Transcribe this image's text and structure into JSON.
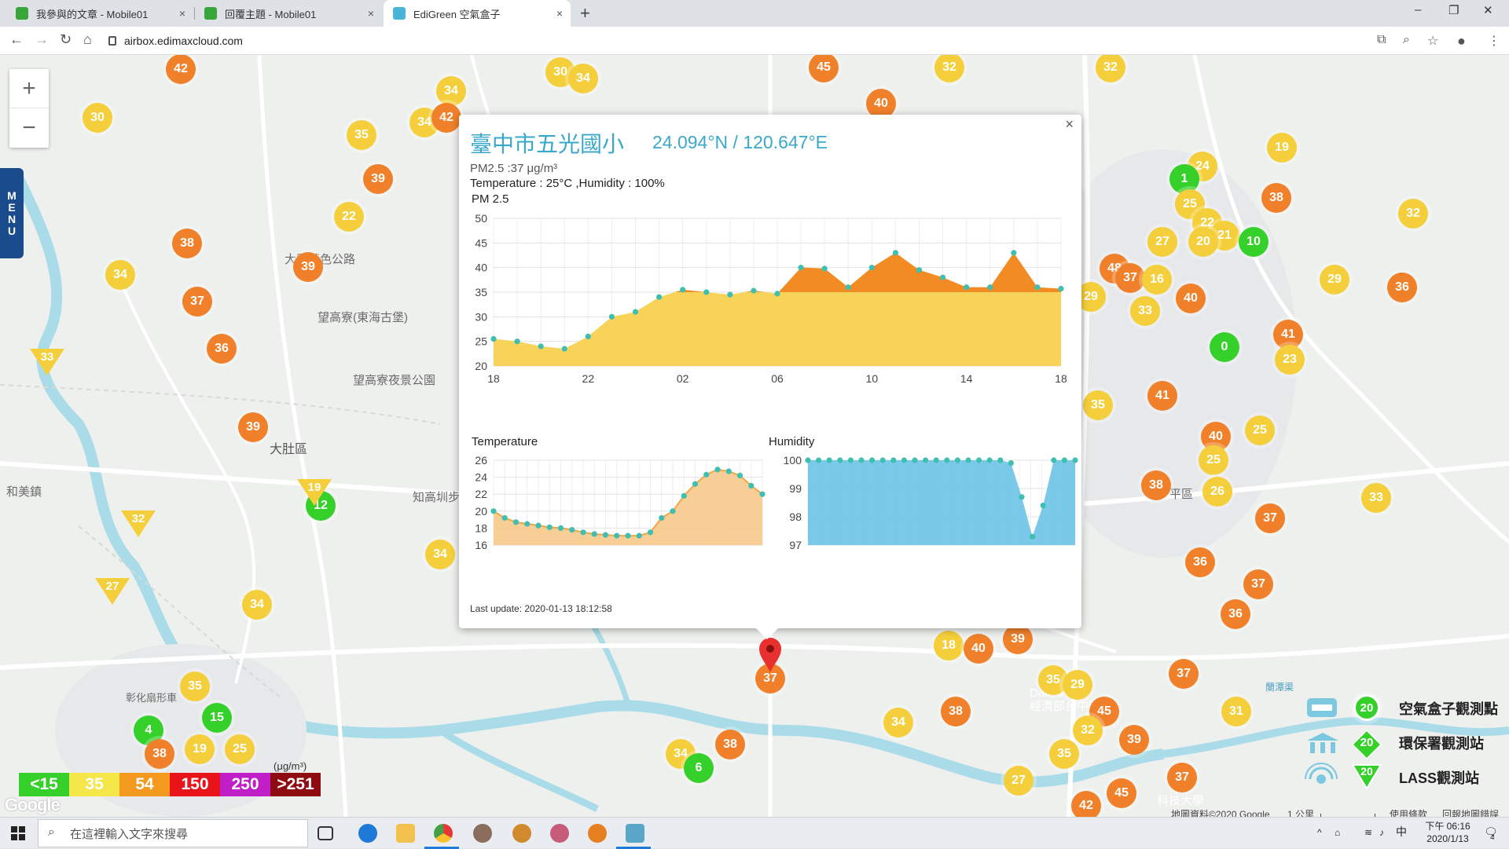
{
  "browser": {
    "tabs": [
      {
        "label": "我參與的文章 - Mobile01",
        "close": "×"
      },
      {
        "label": "回覆主題 - Mobile01",
        "close": "×"
      },
      {
        "label": "EdiGreen 空氣盒子",
        "close": "×"
      }
    ],
    "new_tab": "+",
    "url": "airbox.edimaxcloud.com",
    "window_controls": {
      "minimize": "–",
      "restore": "❐",
      "close": "✕"
    }
  },
  "map": {
    "zoom_in": "+",
    "zoom_out": "−",
    "menu_label": "MENU",
    "place_labels": [
      "大肚區",
      "知高圳步",
      "大肚藍色公路",
      "望高寮(東海古堡)",
      "望高寮夜景公園",
      "和美鎮",
      "彰化扇形車",
      "平區",
      "Dali Ar",
      "經濟部台中軟體",
      "科技大學",
      "蘭潭渠"
    ],
    "markers": [
      {
        "v": "42",
        "t": "o",
        "x": 230,
        "y": 88
      },
      {
        "v": "30",
        "t": "y",
        "x": 124,
        "y": 150
      },
      {
        "v": "30",
        "t": "y",
        "x": 713,
        "y": 92
      },
      {
        "v": "34",
        "t": "y",
        "x": 742,
        "y": 100
      },
      {
        "v": "34",
        "t": "y",
        "x": 574,
        "y": 116
      },
      {
        "v": "34",
        "t": "y",
        "x": 540,
        "y": 156
      },
      {
        "v": "42",
        "t": "o",
        "x": 568,
        "y": 150
      },
      {
        "v": "45",
        "t": "o",
        "x": 1048,
        "y": 86
      },
      {
        "v": "40",
        "t": "o",
        "x": 1121,
        "y": 132
      },
      {
        "v": "32",
        "t": "y",
        "x": 1208,
        "y": 86
      },
      {
        "v": "32",
        "t": "y",
        "x": 1413,
        "y": 86
      },
      {
        "v": "35",
        "t": "y",
        "x": 460,
        "y": 172
      },
      {
        "v": "39",
        "t": "o",
        "x": 481,
        "y": 228
      },
      {
        "v": "22",
        "t": "y",
        "x": 444,
        "y": 276
      },
      {
        "v": "38",
        "t": "o",
        "x": 238,
        "y": 310
      },
      {
        "v": "39",
        "t": "o",
        "x": 392,
        "y": 340
      },
      {
        "v": "34",
        "t": "y",
        "x": 153,
        "y": 350
      },
      {
        "v": "37",
        "t": "o",
        "x": 251,
        "y": 384
      },
      {
        "v": "36",
        "t": "o",
        "x": 282,
        "y": 444
      },
      {
        "v": "39",
        "t": "o",
        "x": 322,
        "y": 544
      },
      {
        "v": "12",
        "t": "g",
        "x": 408,
        "y": 644
      },
      {
        "v": "34",
        "t": "y",
        "x": 560,
        "y": 706
      },
      {
        "v": "34",
        "t": "y",
        "x": 327,
        "y": 770
      },
      {
        "v": "35",
        "t": "y",
        "x": 248,
        "y": 874
      },
      {
        "v": "15",
        "t": "g",
        "x": 276,
        "y": 914
      },
      {
        "v": "4",
        "t": "g",
        "x": 189,
        "y": 930
      },
      {
        "v": "38",
        "t": "o",
        "x": 203,
        "y": 960
      },
      {
        "v": "19",
        "t": "y",
        "x": 254,
        "y": 954
      },
      {
        "v": "25",
        "t": "y",
        "x": 305,
        "y": 954
      },
      {
        "v": "34",
        "t": "y",
        "x": 866,
        "y": 960
      },
      {
        "v": "6",
        "t": "g",
        "x": 889,
        "y": 978
      },
      {
        "v": "38",
        "t": "o",
        "x": 929,
        "y": 948
      },
      {
        "v": "18",
        "t": "y",
        "x": 1207,
        "y": 822
      },
      {
        "v": "40",
        "t": "o",
        "x": 1245,
        "y": 826
      },
      {
        "v": "39",
        "t": "o",
        "x": 1295,
        "y": 814
      },
      {
        "v": "34",
        "t": "y",
        "x": 1143,
        "y": 920
      },
      {
        "v": "38",
        "t": "o",
        "x": 1216,
        "y": 906
      },
      {
        "v": "35",
        "t": "y",
        "x": 1340,
        "y": 866
      },
      {
        "v": "29",
        "t": "y",
        "x": 1371,
        "y": 872
      },
      {
        "v": "45",
        "t": "o",
        "x": 1405,
        "y": 906
      },
      {
        "v": "32",
        "t": "y",
        "x": 1384,
        "y": 930
      },
      {
        "v": "39",
        "t": "o",
        "x": 1443,
        "y": 942
      },
      {
        "v": "35",
        "t": "y",
        "x": 1354,
        "y": 960
      },
      {
        "v": "27",
        "t": "y",
        "x": 1296,
        "y": 994
      },
      {
        "v": "42",
        "t": "o",
        "x": 1382,
        "y": 1026
      },
      {
        "v": "45",
        "t": "o",
        "x": 1427,
        "y": 1010
      },
      {
        "v": "37",
        "t": "o",
        "x": 1504,
        "y": 990
      },
      {
        "v": "37",
        "t": "o",
        "x": 1506,
        "y": 858
      },
      {
        "v": "31",
        "t": "y",
        "x": 1573,
        "y": 906
      },
      {
        "v": "19",
        "t": "y",
        "x": 1631,
        "y": 188
      },
      {
        "v": "24",
        "t": "y",
        "x": 1530,
        "y": 212
      },
      {
        "v": "1",
        "t": "g",
        "x": 1507,
        "y": 228
      },
      {
        "v": "25",
        "t": "y",
        "x": 1514,
        "y": 260
      },
      {
        "v": "22",
        "t": "y",
        "x": 1536,
        "y": 284
      },
      {
        "v": "21",
        "t": "y",
        "x": 1558,
        "y": 300
      },
      {
        "v": "27",
        "t": "y",
        "x": 1479,
        "y": 308
      },
      {
        "v": "20",
        "t": "y",
        "x": 1531,
        "y": 308
      },
      {
        "v": "10",
        "t": "g",
        "x": 1595,
        "y": 308
      },
      {
        "v": "38",
        "t": "o",
        "x": 1624,
        "y": 252
      },
      {
        "v": "32",
        "t": "y",
        "x": 1798,
        "y": 272
      },
      {
        "v": "48",
        "t": "o",
        "x": 1418,
        "y": 342
      },
      {
        "v": "37",
        "t": "o",
        "x": 1438,
        "y": 354
      },
      {
        "v": "16",
        "t": "y",
        "x": 1472,
        "y": 356
      },
      {
        "v": "29",
        "t": "y",
        "x": 1388,
        "y": 378
      },
      {
        "v": "33",
        "t": "y",
        "x": 1457,
        "y": 396
      },
      {
        "v": "40",
        "t": "o",
        "x": 1515,
        "y": 380
      },
      {
        "v": "29",
        "t": "y",
        "x": 1698,
        "y": 356
      },
      {
        "v": "36",
        "t": "o",
        "x": 1784,
        "y": 366
      },
      {
        "v": "0",
        "t": "g",
        "x": 1558,
        "y": 442
      },
      {
        "v": "41",
        "t": "o",
        "x": 1639,
        "y": 426
      },
      {
        "v": "23",
        "t": "y",
        "x": 1641,
        "y": 458
      },
      {
        "v": "41",
        "t": "o",
        "x": 1479,
        "y": 504
      },
      {
        "v": "35",
        "t": "y",
        "x": 1397,
        "y": 516
      },
      {
        "v": "40",
        "t": "o",
        "x": 1547,
        "y": 556
      },
      {
        "v": "25",
        "t": "y",
        "x": 1603,
        "y": 548
      },
      {
        "v": "25",
        "t": "y",
        "x": 1544,
        "y": 586
      },
      {
        "v": "26",
        "t": "y",
        "x": 1549,
        "y": 626
      },
      {
        "v": "38",
        "t": "o",
        "x": 1471,
        "y": 618
      },
      {
        "v": "37",
        "t": "o",
        "x": 1616,
        "y": 660
      },
      {
        "v": "33",
        "t": "y",
        "x": 1751,
        "y": 634
      },
      {
        "v": "36",
        "t": "o",
        "x": 1527,
        "y": 716
      },
      {
        "v": "37",
        "t": "o",
        "x": 1601,
        "y": 744
      },
      {
        "v": "36",
        "t": "o",
        "x": 1572,
        "y": 782
      },
      {
        "v": "37",
        "t": "o",
        "x": 980,
        "y": 864
      }
    ],
    "triangles": [
      {
        "v": "33",
        "x": 60,
        "y": 460
      },
      {
        "v": "19",
        "x": 400,
        "y": 626
      },
      {
        "v": "32",
        "x": 176,
        "y": 666
      },
      {
        "v": "27",
        "x": 143,
        "y": 752
      }
    ],
    "aqi_scale": [
      {
        "label": "<15",
        "color": "#35d12a"
      },
      {
        "label": "35",
        "color": "#f5e64a"
      },
      {
        "label": "54",
        "color": "#f39a1e"
      },
      {
        "label": "150",
        "color": "#e8141a"
      },
      {
        "label": "250",
        "color": "#c01fc8"
      },
      {
        "label": ">251",
        "color": "#8e0b12"
      }
    ],
    "aqi_unit": "(μg/m³)",
    "google_logo": "Google",
    "legend": [
      {
        "label": "空氣盒子觀測點",
        "badge": "20"
      },
      {
        "label": "環保署觀測站",
        "badge": "20"
      },
      {
        "label": "LASS觀測站",
        "badge": "20"
      }
    ],
    "credits": [
      "地圖資料©2020 Google",
      "1 公里",
      "使用條款",
      "回報地圖錯誤"
    ]
  },
  "popup": {
    "close": "×",
    "station": "臺中市五光國小",
    "coords": "24.094°N / 120.647°E",
    "pm25_line": "PM2.5 :37 μg/m³",
    "temp_hum_line": "Temperature : 25°C ,Humidity : 100%",
    "pm_chart_label": "PM 2.5",
    "temp_chart_label": "Temperature",
    "hum_chart_label": "Humidity",
    "last_update": "Last update: 2020-01-13 18:12:58"
  },
  "chart_data": [
    {
      "type": "area",
      "title": "PM 2.5",
      "x_tick_labels": [
        "18",
        "22",
        "02",
        "06",
        "10",
        "14",
        "18"
      ],
      "ylim": [
        20,
        50
      ],
      "y_ticks": [
        20,
        25,
        30,
        35,
        40,
        45,
        50
      ],
      "threshold": 35,
      "series": [
        {
          "values": [
            25.5,
            25,
            24,
            23.5,
            26,
            30,
            31,
            34,
            35.5,
            35,
            34.5,
            35.3,
            34.7,
            40,
            39.8,
            36,
            40,
            43,
            39.5,
            38,
            36,
            36,
            43,
            36,
            35.7
          ]
        }
      ],
      "colors": {
        "below": "#f7d35a",
        "above": "#f28b24",
        "point": "#3fbfb0"
      }
    },
    {
      "type": "area",
      "title": "Temperature",
      "ylim": [
        16,
        26
      ],
      "y_ticks": [
        16,
        18,
        20,
        22,
        24,
        26
      ],
      "series": [
        {
          "values": [
            20,
            19.2,
            18.7,
            18.5,
            18.3,
            18.1,
            18,
            17.8,
            17.5,
            17.3,
            17.2,
            17.1,
            17.1,
            17.1,
            17.5,
            19.2,
            20,
            21.8,
            23.2,
            24.3,
            24.9,
            24.7,
            24.2,
            23,
            22
          ]
        }
      ],
      "colors": {
        "fill": "#f6c98a",
        "line": "#f0a646",
        "point": "#3fbfb0"
      }
    },
    {
      "type": "area",
      "title": "Humidity",
      "ylim": [
        97,
        100
      ],
      "y_ticks": [
        97,
        98,
        99,
        100
      ],
      "series": [
        {
          "values": [
            100,
            100,
            100,
            100,
            100,
            100,
            100,
            100,
            100,
            100,
            100,
            100,
            100,
            100,
            100,
            100,
            100,
            100,
            100,
            99.9,
            98.7,
            97.3,
            98.4,
            100,
            100,
            100
          ]
        }
      ],
      "colors": {
        "fill": "#6cc3e6",
        "point": "#3fbfb0"
      }
    }
  ],
  "taskbar": {
    "search_placeholder": "在這裡輸入文字來搜尋",
    "clock_time": "下午 06:16",
    "clock_date": "2020/1/13",
    "ime": "中",
    "notif_count": "4"
  }
}
